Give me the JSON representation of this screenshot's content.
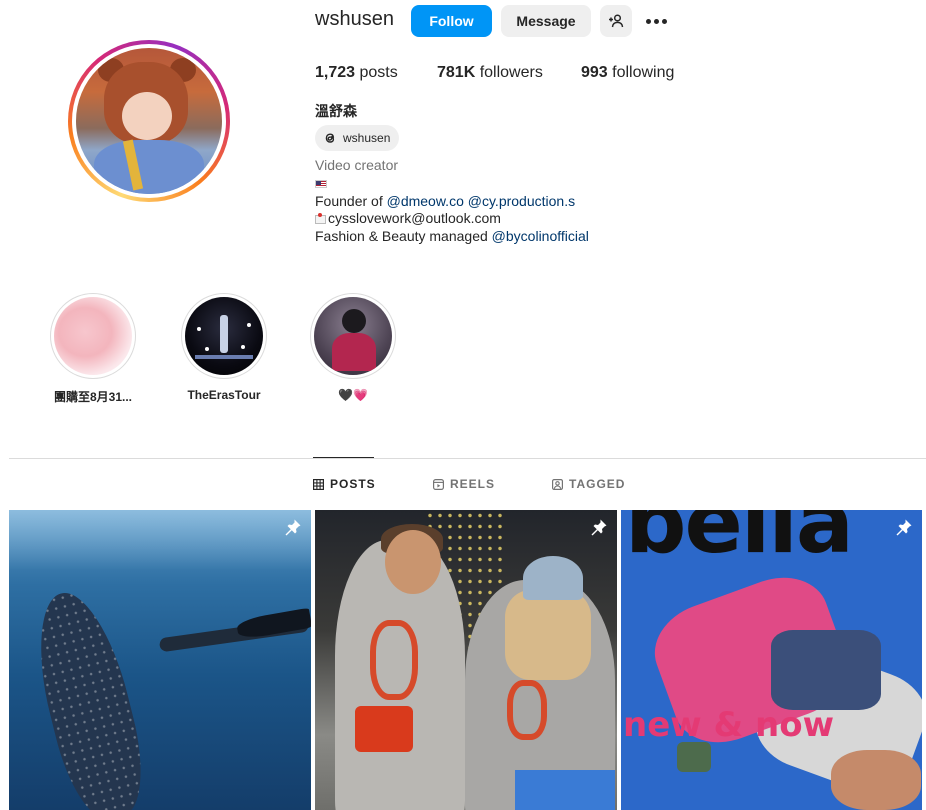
{
  "header": {
    "username": "wshusen",
    "follow_label": "Follow",
    "message_label": "Message"
  },
  "stats": {
    "posts_count": "1,723",
    "posts_label": " posts",
    "followers_count": "781K",
    "followers_label": " followers",
    "following_count": "993",
    "following_label": " following"
  },
  "profile": {
    "full_name": "溫舒森",
    "threads_handle": "wshusen",
    "category": "Video creator",
    "bio": {
      "founder_prefix": "Founder of ",
      "founder_link1": "@dmeow.co",
      "founder_link2": "@cy.production.s",
      "email": "cysslovework@outlook.com",
      "managed_prefix": "Fashion & Beauty managed ",
      "managed_link": "@bycolinofficial"
    }
  },
  "highlights": [
    {
      "label": "團購至8月31..."
    },
    {
      "label": "TheErasTour"
    },
    {
      "label": "🖤💗"
    }
  ],
  "tabs": [
    {
      "label": "POSTS",
      "active": true
    },
    {
      "label": "REELS",
      "active": false
    },
    {
      "label": "TAGGED",
      "active": false
    }
  ],
  "posts": [
    {
      "pinned": true
    },
    {
      "pinned": true
    },
    {
      "pinned": true,
      "cover_title": "bella",
      "cover_text": "new & now"
    }
  ],
  "colors": {
    "follow_button": "#0095f6",
    "link": "#00376b",
    "secondary_text": "#737373"
  }
}
